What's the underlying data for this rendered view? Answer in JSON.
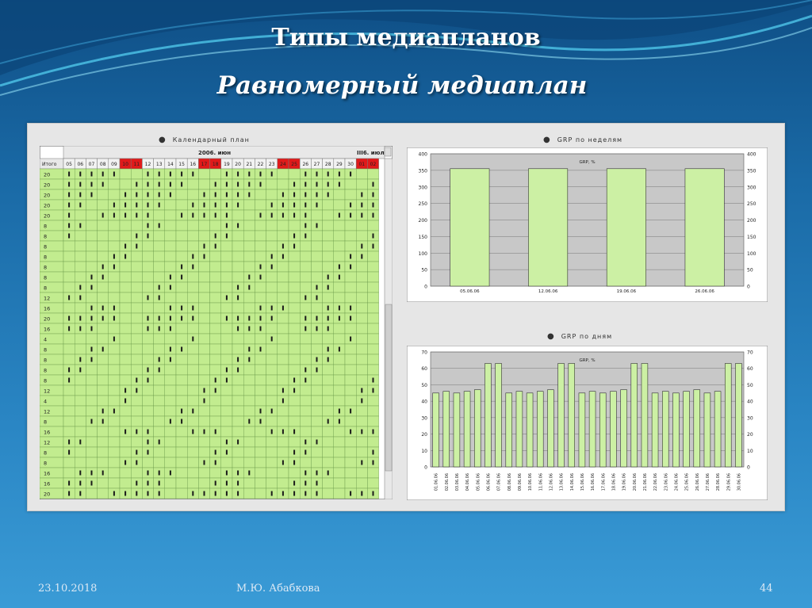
{
  "slide": {
    "title": "Типы медиапланов",
    "subtitle": "Равномерный медиаплан",
    "footer": {
      "date": "23.10.2018",
      "author": "М.Ю. Абабкова",
      "page": "44"
    }
  },
  "calendar": {
    "title": "Календарный план",
    "month_label": "2006. июн",
    "next_month_label": "III6. июл",
    "total_header": "Итого",
    "days": [
      "05",
      "06",
      "07",
      "08",
      "09",
      "10",
      "11",
      "12",
      "13",
      "14",
      "15",
      "16",
      "17",
      "18",
      "19",
      "20",
      "21",
      "22",
      "23",
      "24",
      "25",
      "26",
      "27",
      "28",
      "29",
      "30",
      "01",
      "02"
    ],
    "weekend_days": [
      "10",
      "11",
      "17",
      "18",
      "24",
      "25",
      "01",
      "02"
    ],
    "totals": [
      "20",
      "20",
      "20",
      "20",
      "20",
      "8",
      "8",
      "8",
      "8",
      "8",
      "8",
      "8",
      "12",
      "16",
      "20",
      "16",
      "4",
      "8",
      "8",
      "8",
      "8",
      "12",
      "4",
      "12",
      "8",
      "16",
      "12",
      "8",
      "8",
      "16",
      "16",
      "20"
    ]
  },
  "chart_data": [
    {
      "type": "bar",
      "title": "GRP, %",
      "panel_title": "GRP по неделям",
      "categories": [
        "05.06.06",
        "12.06.06",
        "19.06.06",
        "26.06.06"
      ],
      "values": [
        355,
        355,
        355,
        355
      ],
      "ylim": [
        0,
        400
      ],
      "yticks": [
        0,
        50,
        100,
        150,
        200,
        250,
        300,
        350,
        400
      ],
      "right_yticks": [
        "0",
        "50",
        "100",
        "150",
        "200",
        "250",
        "300",
        "350",
        "400"
      ],
      "bar_color": "#ccf0a4",
      "grid": true,
      "legend": "none"
    },
    {
      "type": "bar",
      "title": "GRP, %",
      "panel_title": "GRP по дням",
      "categories": [
        "01.06.06",
        "02.06.06",
        "03.06.06",
        "04.06.06",
        "05.06.06",
        "06.06.06",
        "07.06.06",
        "08.06.06",
        "09.06.06",
        "10.06.06",
        "11.06.06",
        "12.06.06",
        "13.06.06",
        "14.06.06",
        "15.06.06",
        "16.06.06",
        "17.06.06",
        "18.06.06",
        "19.06.06",
        "20.06.06",
        "21.06.06",
        "22.06.06",
        "23.06.06",
        "24.06.06",
        "25.06.06",
        "26.06.06",
        "27.06.06",
        "28.06.06",
        "29.06.06",
        "30.06.06"
      ],
      "values": [
        45,
        46,
        45,
        46,
        47,
        63,
        63,
        45,
        46,
        45,
        46,
        47,
        63,
        63,
        45,
        46,
        45,
        46,
        47,
        63,
        63,
        45,
        46,
        45,
        46,
        47,
        45,
        46,
        63,
        63
      ],
      "ylim": [
        0,
        70
      ],
      "yticks": [
        0,
        10,
        20,
        30,
        40,
        50,
        60,
        70
      ],
      "bar_color": "#ccf0a4",
      "grid": true,
      "legend": "none"
    }
  ],
  "colors": {
    "grid_fill": "#c2ec8f",
    "weekend": "#e01a1a",
    "bar": "#ccf0a4"
  }
}
